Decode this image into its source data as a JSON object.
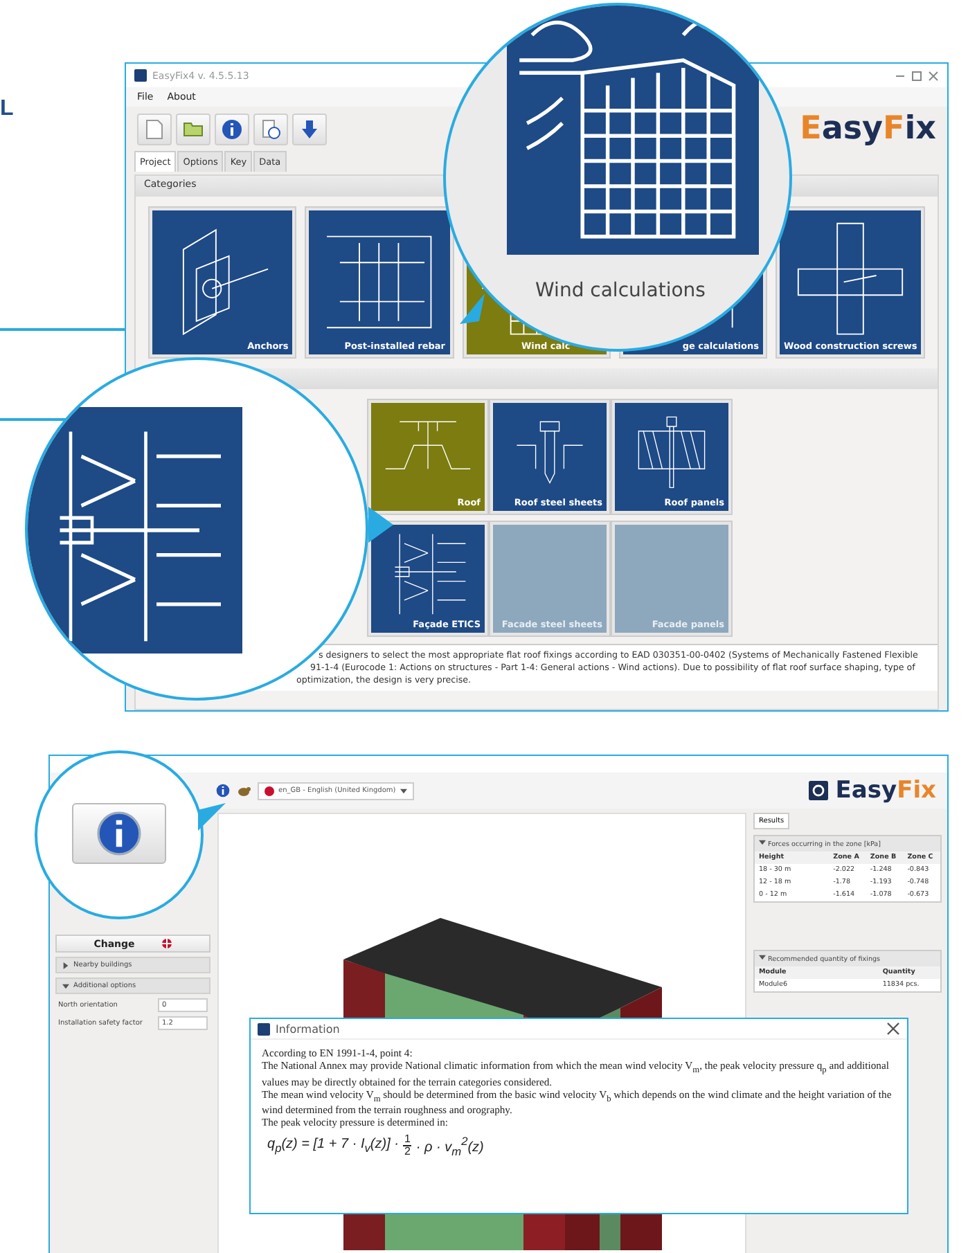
{
  "heading": "L",
  "window1": {
    "title": "EasyFix4 v. 4.5.5.13",
    "menu": [
      "File",
      "About"
    ],
    "logo": [
      {
        "text": "E",
        "accent": true
      },
      {
        "text": "asy",
        "accent": false
      },
      {
        "text": "F",
        "accent": true
      },
      {
        "text": "ix",
        "accent": false
      }
    ],
    "tabs": [
      {
        "label": "Project",
        "selected": true
      },
      {
        "label": "Options",
        "selected": false
      },
      {
        "label": "Key",
        "selected": false
      },
      {
        "label": "Data",
        "selected": false
      }
    ],
    "section": "Categories",
    "categories": [
      {
        "label": "Anchors",
        "kind": "anchor",
        "selected": false,
        "disabled": false
      },
      {
        "label": "Post-installed rebar",
        "kind": "rebar",
        "selected": false,
        "disabled": false
      },
      {
        "label": "Wind calc",
        "kind": "wind",
        "selected": true,
        "disabled": false
      },
      {
        "label": "ge calculations",
        "kind": "bridge",
        "selected": false,
        "disabled": false
      },
      {
        "label": "Wood construction screws",
        "kind": "wood",
        "selected": false,
        "disabled": false
      }
    ],
    "products": [
      {
        "label": "Roof",
        "kind": "roof",
        "selected": true,
        "disabled": false
      },
      {
        "label": "Roof steel sheets",
        "kind": "screw",
        "selected": false,
        "disabled": false
      },
      {
        "label": "Roof panels",
        "kind": "panel",
        "selected": false,
        "disabled": false
      },
      {
        "label": "Façade ETICS",
        "kind": "etics",
        "selected": false,
        "disabled": false
      },
      {
        "label": "Facade steel sheets",
        "kind": "blank",
        "selected": false,
        "disabled": true
      },
      {
        "label": "Facade panels",
        "kind": "blank",
        "selected": false,
        "disabled": true
      }
    ],
    "description_lines": [
      "s designers to select the most appropriate flat roof fixings according to EAD 030351-00-0402 (Systems of Mechanically Fastened Flexible",
      "91-1-4 (Eurocode 1: Actions on structures - Part 1-4: General actions - Wind actions). Due to possibility of flat roof surface shaping, type of",
      "optimization, the design is very precise."
    ]
  },
  "zoom_wind": {
    "label": "Wind calculations"
  },
  "window2": {
    "language": "en_GB - English (United Kingdom)",
    "logo": [
      {
        "text": "E",
        "accent": false
      },
      {
        "text": "asy",
        "accent": false
      },
      {
        "text": "F",
        "accent": true
      },
      {
        "text": "ix",
        "accent": true
      }
    ],
    "change_button": "Change",
    "sections": [
      {
        "label": "Nearby buildings",
        "expanded": false
      },
      {
        "label": "Additional options",
        "expanded": true
      }
    ],
    "fields": [
      {
        "label": "North orientation",
        "value": "0"
      },
      {
        "label": "Installation safety factor",
        "value": "1.2"
      }
    ],
    "results_tab": "Results",
    "forces": {
      "title": "Forces occurring in the zone [kPa]",
      "columns": [
        "Height",
        "Zone A",
        "Zone B",
        "Zone C"
      ],
      "rows": [
        [
          "18 - 30 m",
          "-2.022",
          "-1.248",
          "-0.843"
        ],
        [
          "12 - 18 m",
          "-1.78",
          "-1.193",
          "-0.748"
        ],
        [
          "0 - 12 m",
          "-1.614",
          "-1.078",
          "-0.673"
        ]
      ]
    },
    "fixings": {
      "title": "Recommended quantity of fixings",
      "columns": [
        "Module",
        "Quantity"
      ],
      "rows": [
        [
          "Module6",
          "11834 pcs."
        ]
      ]
    },
    "dialog": {
      "title": "Information",
      "lines": [
        "According to EN 1991-1-4, point 4:",
        "The National Annex may provide National climatic information from which the mean wind velocity V$_{m}$, the peak velocity pressure q$_{p}$ and additional values may be directly obtained for the terrain categories considered.",
        "The mean wind velocity V$_{m}$ should be determined from the basic wind velocity V$_{b}$ which depends on the wind climate and the height variation of the wind determined from the terrain roughness and orography.",
        "The peak velocity pressure is determined in:"
      ],
      "formula": {
        "lhs": "q$_{p}$(z) = [1 + 7 · I$_{v}$(z)] ·",
        "numerator": "1",
        "denominator": "2",
        "rhs": "· ρ · v$_{m}$$^{2}$(z)"
      }
    }
  }
}
